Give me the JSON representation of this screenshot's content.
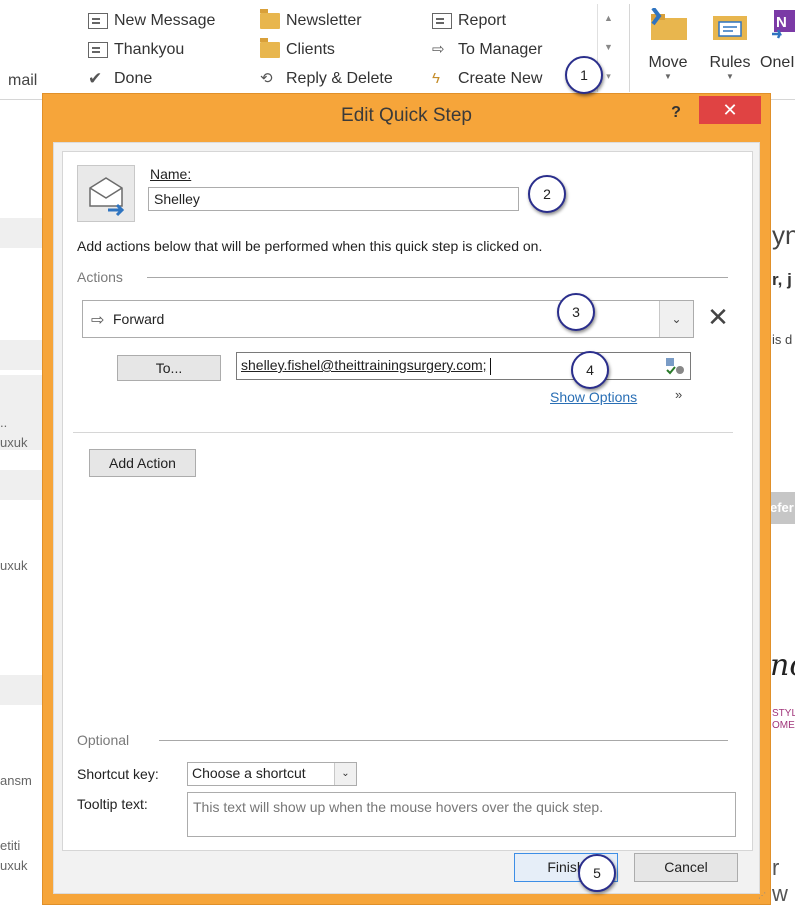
{
  "ribbon": {
    "left_tab": "mail",
    "quick_steps": [
      {
        "label": "New Message",
        "icon": "mail-icon"
      },
      {
        "label": "Thankyou",
        "icon": "mail-icon"
      },
      {
        "label": "Done",
        "icon": "check-icon"
      },
      {
        "label": "Newsletter",
        "icon": "folder-icon"
      },
      {
        "label": "Clients",
        "icon": "folder-icon"
      },
      {
        "label": "Reply & Delete",
        "icon": "reply-delete-icon"
      },
      {
        "label": "Report",
        "icon": "mail-icon"
      },
      {
        "label": "To Manager",
        "icon": "forward-icon"
      },
      {
        "label": "Create New",
        "icon": "lightning-icon"
      }
    ],
    "move_label": "Move",
    "rules_label": "Rules",
    "onenote_label": "OneI"
  },
  "background": {
    "left_fragments": [
      "..",
      "uxuk",
      "uxuk",
      "ansm",
      "etiti",
      "uxuk"
    ],
    "right_fragments": [
      "yn",
      "r, j",
      "is d",
      "efer",
      "nc",
      "STYLI",
      "OME",
      "r w"
    ]
  },
  "dialog": {
    "title": "Edit Quick Step",
    "help_label": "?",
    "close_label": "✕",
    "name_label": "Name:",
    "name_value": "Shelley",
    "description": "Add actions below that will be performed when this quick step is clicked on.",
    "actions_legend": "Actions",
    "action_value": "Forward",
    "remove_label": "✕",
    "to_button": "To...",
    "to_value": "shelley.fishel@theittrainingsurgery.com;",
    "show_options": "Show Options",
    "add_action": "Add Action",
    "optional_legend": "Optional",
    "shortcut_label": "Shortcut key:",
    "shortcut_value": "Choose a shortcut",
    "tooltip_label": "Tooltip text:",
    "tooltip_placeholder": "This text will show up when the mouse hovers over the quick step.",
    "finish_label": "Finish",
    "cancel_label": "Cancel"
  },
  "callouts": [
    "1",
    "2",
    "3",
    "4",
    "5"
  ],
  "colors": {
    "dialog_frame": "#f6a53a",
    "close_button": "#e04343",
    "link": "#2a6fb5",
    "callout_border": "#2a2e8c"
  }
}
